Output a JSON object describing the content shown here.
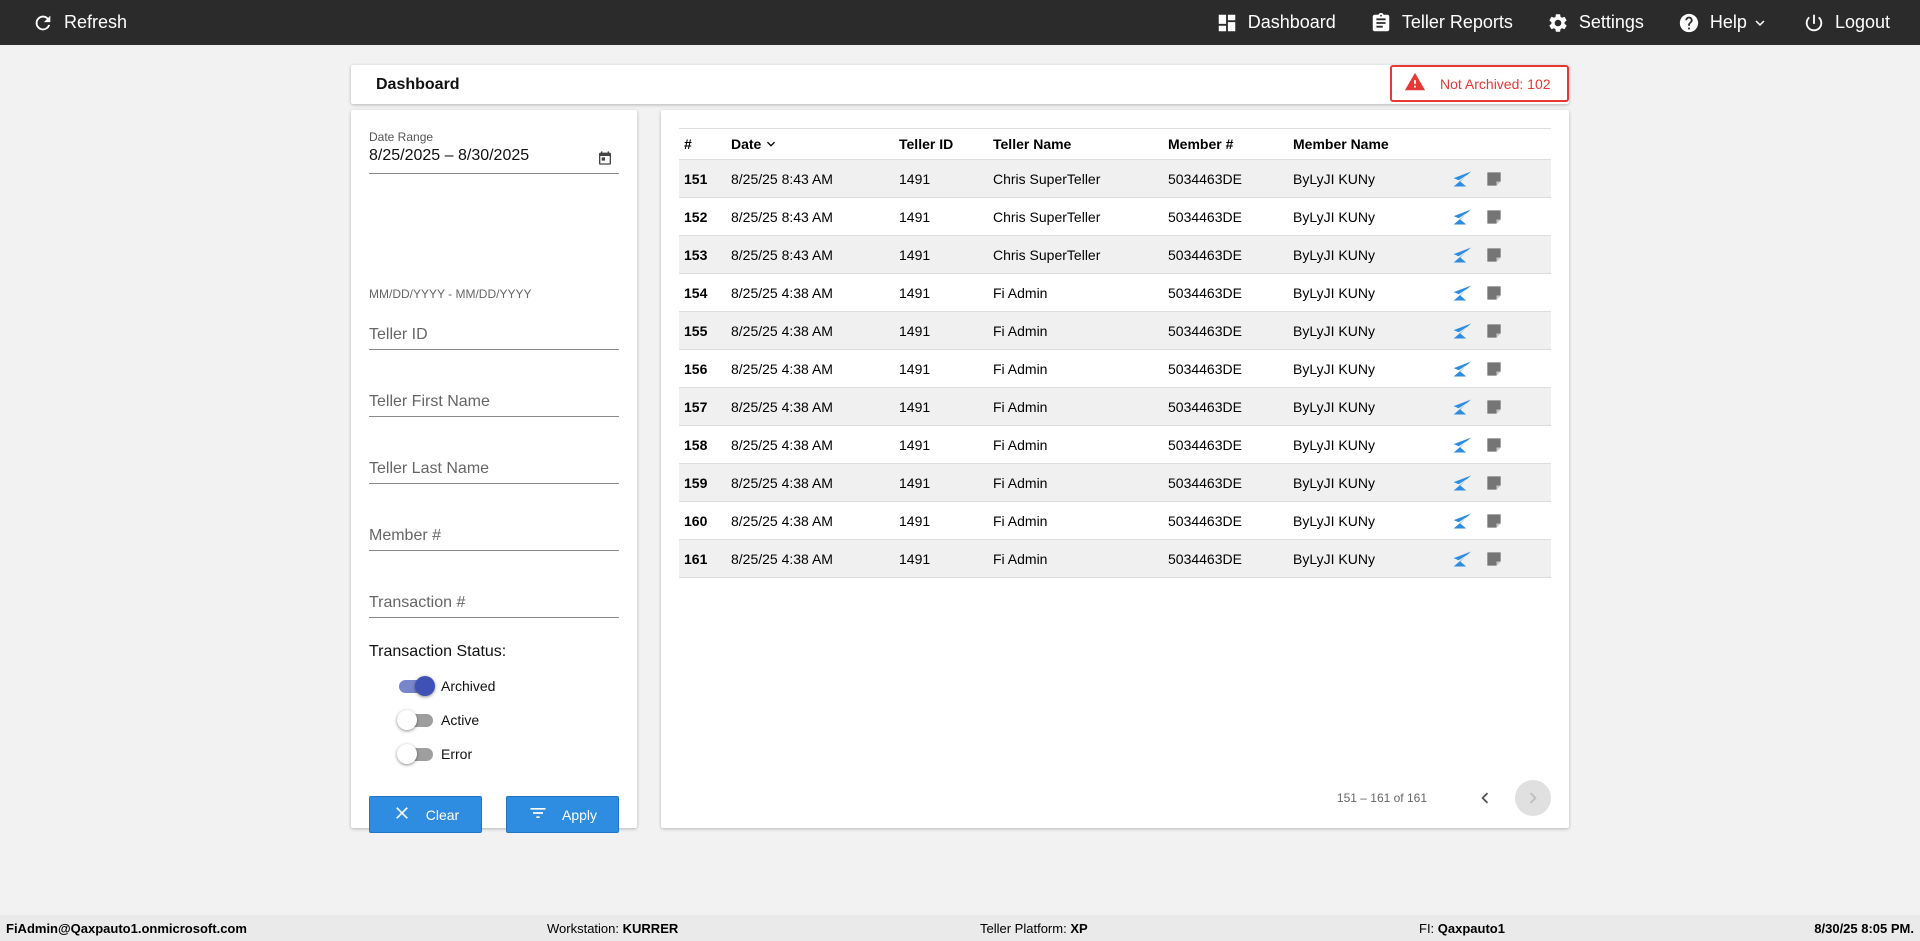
{
  "topbar": {
    "refresh_label": "Refresh",
    "dashboard_label": "Dashboard",
    "teller_reports_label": "Teller Reports",
    "settings_label": "Settings",
    "help_label": "Help",
    "logout_label": "Logout"
  },
  "header": {
    "title": "Dashboard",
    "not_archived": "Not Archived: 102"
  },
  "filters": {
    "date_range_label": "Date Range",
    "date_range_value": "8/25/2025 – 8/30/2025",
    "date_hint": "MM/DD/YYYY - MM/DD/YYYY",
    "teller_id_placeholder": "Teller ID",
    "teller_first_name_placeholder": "Teller First Name",
    "teller_last_name_placeholder": "Teller Last Name",
    "member_placeholder": "Member #",
    "transaction_placeholder": "Transaction #",
    "status_label": "Transaction Status:",
    "statuses": [
      {
        "label": "Archived",
        "on": true
      },
      {
        "label": "Active",
        "on": false
      },
      {
        "label": "Error",
        "on": false
      }
    ],
    "clear_label": "Clear",
    "apply_label": "Apply"
  },
  "table": {
    "columns": [
      "#",
      "Date",
      "Teller ID",
      "Teller Name",
      "Member #",
      "Member Name"
    ],
    "rows": [
      {
        "num": "151",
        "date": "8/25/25 8:43 AM",
        "teller_id": "1491",
        "teller_name": "Chris SuperTeller",
        "member_num": "5034463DE",
        "member_name": "ByLyJI KUNy"
      },
      {
        "num": "152",
        "date": "8/25/25 8:43 AM",
        "teller_id": "1491",
        "teller_name": "Chris SuperTeller",
        "member_num": "5034463DE",
        "member_name": "ByLyJI KUNy"
      },
      {
        "num": "153",
        "date": "8/25/25 8:43 AM",
        "teller_id": "1491",
        "teller_name": "Chris SuperTeller",
        "member_num": "5034463DE",
        "member_name": "ByLyJI KUNy"
      },
      {
        "num": "154",
        "date": "8/25/25 4:38 AM",
        "teller_id": "1491",
        "teller_name": "Fi Admin",
        "member_num": "5034463DE",
        "member_name": "ByLyJI KUNy"
      },
      {
        "num": "155",
        "date": "8/25/25 4:38 AM",
        "teller_id": "1491",
        "teller_name": "Fi Admin",
        "member_num": "5034463DE",
        "member_name": "ByLyJI KUNy"
      },
      {
        "num": "156",
        "date": "8/25/25 4:38 AM",
        "teller_id": "1491",
        "teller_name": "Fi Admin",
        "member_num": "5034463DE",
        "member_name": "ByLyJI KUNy"
      },
      {
        "num": "157",
        "date": "8/25/25 4:38 AM",
        "teller_id": "1491",
        "teller_name": "Fi Admin",
        "member_num": "5034463DE",
        "member_name": "ByLyJI KUNy"
      },
      {
        "num": "158",
        "date": "8/25/25 4:38 AM",
        "teller_id": "1491",
        "teller_name": "Fi Admin",
        "member_num": "5034463DE",
        "member_name": "ByLyJI KUNy"
      },
      {
        "num": "159",
        "date": "8/25/25 4:38 AM",
        "teller_id": "1491",
        "teller_name": "Fi Admin",
        "member_num": "5034463DE",
        "member_name": "ByLyJI KUNy"
      },
      {
        "num": "160",
        "date": "8/25/25 4:38 AM",
        "teller_id": "1491",
        "teller_name": "Fi Admin",
        "member_num": "5034463DE",
        "member_name": "ByLyJI KUNy"
      },
      {
        "num": "161",
        "date": "8/25/25 4:38 AM",
        "teller_id": "1491",
        "teller_name": "Fi Admin",
        "member_num": "5034463DE",
        "member_name": "ByLyJI KUNy"
      }
    ],
    "paginator_range": "151 – 161 of 161"
  },
  "footer": {
    "user": "FiAdmin@Qaxpauto1.onmicrosoft.com",
    "workstation_label": "Workstation:",
    "workstation_value": "KURRER",
    "platform_label": "Teller Platform:",
    "platform_value": "XP",
    "fi_label": "FI:",
    "fi_value": "Qaxpauto1",
    "datetime": "8/30/25 8:05 PM."
  },
  "colors": {
    "accent": "#2e8de0",
    "alert": "#e53935",
    "toggle_on": "#3f51b5",
    "topbar": "#2b2b2b"
  },
  "icons": [
    "refresh-icon",
    "dashboard-icon",
    "clipboard-icon",
    "gear-icon",
    "help-icon",
    "chevron-down-icon",
    "power-icon",
    "warning-icon",
    "calendar-icon",
    "close-icon",
    "filter-icon",
    "send-icon",
    "note-icon",
    "chevron-left-icon",
    "chevron-right-icon"
  ]
}
